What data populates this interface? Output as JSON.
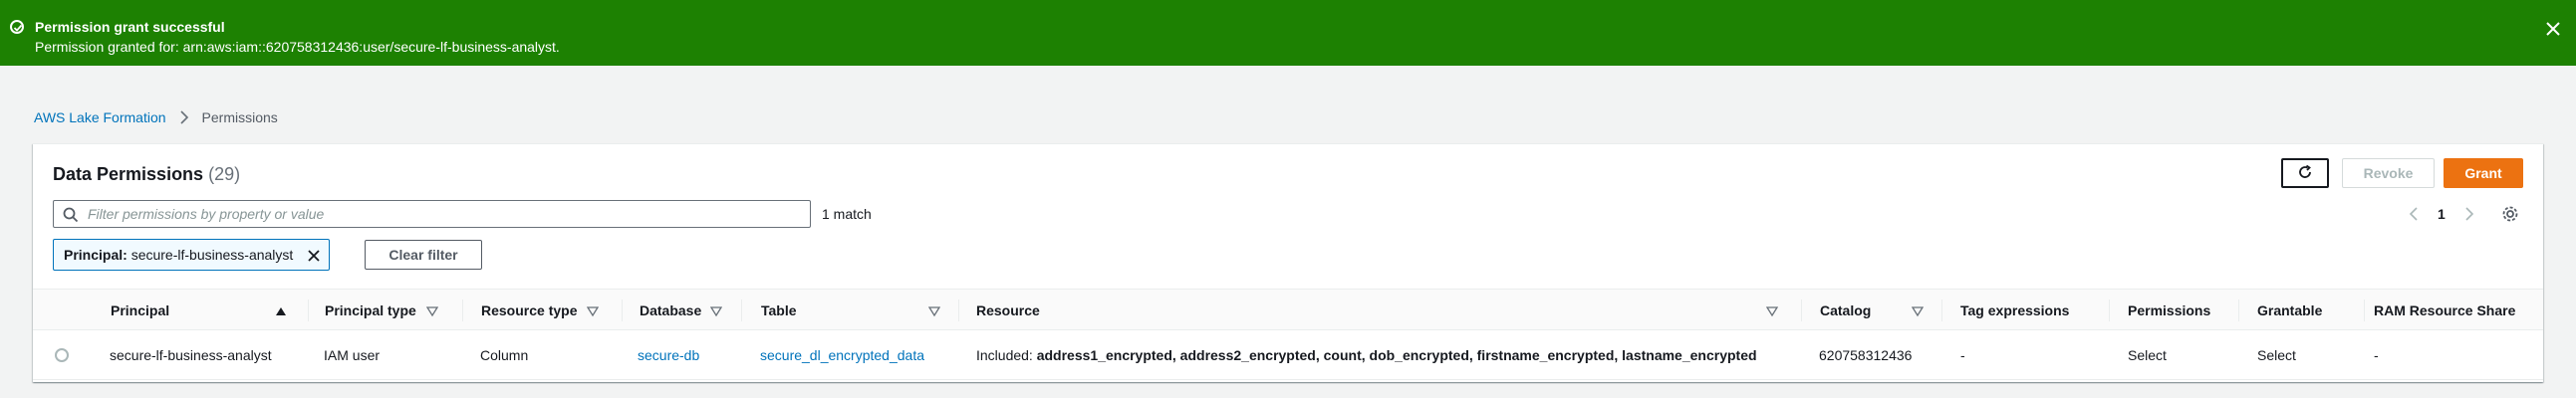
{
  "flash": {
    "title": "Permission grant successful",
    "message": "Permission granted for: arn:aws:iam::620758312436:user/secure-lf-business-analyst.",
    "color": "#1d8102"
  },
  "breadcrumb": {
    "items": [
      "AWS Lake Formation",
      "Permissions"
    ]
  },
  "panel": {
    "title": "Data Permissions",
    "count": "(29)",
    "buttons": {
      "refresh_icon": "refresh-icon",
      "revoke": "Revoke",
      "grant": "Grant"
    },
    "filter": {
      "placeholder": "Filter permissions by property or value",
      "value": "",
      "match_text": "1 match"
    },
    "pagination": {
      "current_page": "1"
    },
    "token": {
      "key": "Principal:",
      "value": "secure-lf-business-analyst"
    },
    "clear_filter": "Clear filter"
  },
  "table": {
    "columns": [
      "Principal",
      "Principal type",
      "Resource type",
      "Database",
      "Table",
      "Resource",
      "Catalog",
      "Tag expressions",
      "Permissions",
      "Grantable",
      "RAM Resource Share"
    ],
    "rows": [
      {
        "principal": "secure-lf-business-analyst",
        "principal_type": "IAM user",
        "resource_type": "Column",
        "database": "secure-db",
        "table": "secure_dl_encrypted_data",
        "resource_prefix": "Included: ",
        "resource_columns": "address1_encrypted, address2_encrypted, count, dob_encrypted, firstname_encrypted, lastname_encrypted",
        "catalog": "620758312436",
        "tag_expressions": "-",
        "permissions": "Select",
        "grantable": "Select",
        "ram_resource_share": "-"
      }
    ]
  },
  "colors": {
    "accent": "#ec7211",
    "link": "#0073bb",
    "success": "#1d8102"
  }
}
